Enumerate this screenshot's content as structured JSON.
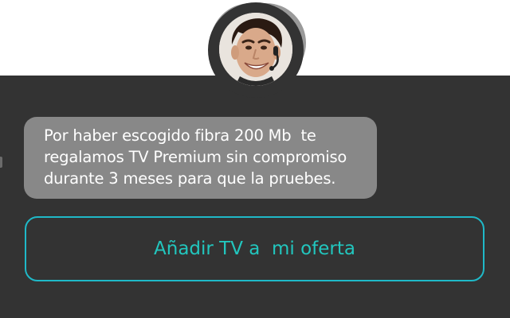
{
  "chat": {
    "agent": {
      "avatar_icon": "agent-avatar-with-headset"
    },
    "message": {
      "lines": [
        "Por haber escogido fibra 200 Mb  te",
        "regalamos TV Premium sin compromiso",
        "durante 3 meses para que la pruebes."
      ]
    },
    "action": {
      "label": "Añadir TV a  mi oferta"
    }
  },
  "colors": {
    "background_top": "#ffffff",
    "panel": "#333333",
    "bubble": "#888888",
    "bubble_text": "#ffffff",
    "accent": "#1fb9c8",
    "accent_text": "#22c6be"
  }
}
